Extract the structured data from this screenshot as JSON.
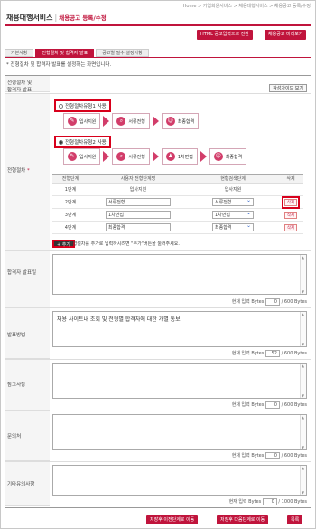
{
  "breadcrumb": "Home > 기업회원서비스 > 채용대행서비스 > 채용공고 등록/수정",
  "title": "채용대행서비스",
  "subtitle": "채용공고 등록/수정",
  "top_buttons": {
    "html_edit": "HTML 공고입력으로 전환",
    "preview": "채용공고 미리보기"
  },
  "tabs": [
    "기본사항",
    "전형절차 및 합격자 발표",
    "공고별 필수 설정사항"
  ],
  "note": "* 전형절차 및 합격자 발표를 설정하는 화면입니다.",
  "section": {
    "announce_label_1": "전형절차 및",
    "announce_label_2": "합격자 발표",
    "guide_button": "작성가이드 보기",
    "process_label": "전형절차",
    "process_required": "*"
  },
  "process_types": [
    {
      "label": "전형절차유형1 사용",
      "selected": false,
      "steps": [
        "입사지원",
        "서류전형",
        "최종합격"
      ]
    },
    {
      "label": "전형절차유형2 사용",
      "selected": true,
      "steps": [
        "입사지원",
        "서류전형",
        "1차면접",
        "최종합격"
      ]
    }
  ],
  "stage_table": {
    "headers": [
      "전형단계",
      "사용자 전형단계명",
      "현황검색단계",
      "삭제"
    ],
    "rows": [
      {
        "stage": "1단계",
        "name": "입사지원",
        "status": "입사지원",
        "delete": ""
      },
      {
        "stage": "2단계",
        "name": "서류전형",
        "status": "서류전형",
        "delete": "삭제"
      },
      {
        "stage": "3단계",
        "name": "1차면접",
        "status": "1차면접",
        "delete": "삭제"
      },
      {
        "stage": "4단계",
        "name": "최종합격",
        "status": "최종합격",
        "delete": "삭제"
      }
    ]
  },
  "add_button": "+ 추가",
  "add_note": "전형절차를 추가로 입력하시려면 \"추가\"버튼을 눌러주세요.",
  "fields": [
    {
      "label": "합격자 발표일",
      "value": "",
      "count_label": "현재 입력 Bytes",
      "count": "0",
      "max": "/ 600 Bytes"
    },
    {
      "label": "발표방법",
      "value": "채용 사이트내 조회 및 전형별 합격자에 대한 개별 통보",
      "count_label": "현재 입력 Bytes",
      "count": "52",
      "max": "/ 600 Bytes"
    },
    {
      "label": "참고사항",
      "value": "",
      "count_label": "현재 입력 Bytes",
      "count": "0",
      "max": "/ 600 Bytes"
    },
    {
      "label": "문의처",
      "value": "",
      "count_label": "현재 입력 Bytes",
      "count": "0",
      "max": "/ 600 Bytes"
    },
    {
      "label": "기타유의사항",
      "value": "",
      "count_label": "현재 입력 Bytes",
      "count": "0",
      "max": "/ 1000 Bytes"
    }
  ],
  "bottom_buttons": {
    "prev": "저장후 이전단계로 이동",
    "next": "저장후 다음단계로 이동",
    "save": "목록"
  }
}
